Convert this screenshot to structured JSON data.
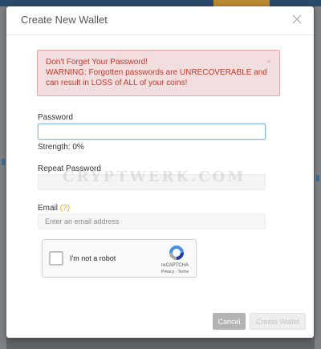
{
  "modal": {
    "title": "Create New Wallet",
    "close_icon": "close-icon"
  },
  "alert": {
    "title": "Don't Forget Your Password!",
    "body": "WARNING: Forgotten passwords are UNRECOVERABLE and can result in LOSS of ALL of your coins!",
    "close_label": "×"
  },
  "form": {
    "password_label": "Password",
    "password_value": "",
    "strength_text": "Strength: 0%",
    "repeat_label": "Repeat Password",
    "repeat_value": "",
    "email_label": "Email",
    "email_help": "(?)",
    "email_placeholder": "Enter an email address"
  },
  "recaptcha": {
    "label": "I'm not a robot",
    "brand": "reCAPTCHA",
    "links": "Privacy - Terms",
    "checked": false
  },
  "watermark": "CRYPTWERK.COM",
  "buttons": {
    "cancel": "Cancel",
    "create": "Create Wallet"
  },
  "colors": {
    "alert_bg": "#f2dede",
    "alert_text": "#c0392b",
    "focus_border": "#8fb8e0",
    "help_mark": "#e0a800"
  }
}
